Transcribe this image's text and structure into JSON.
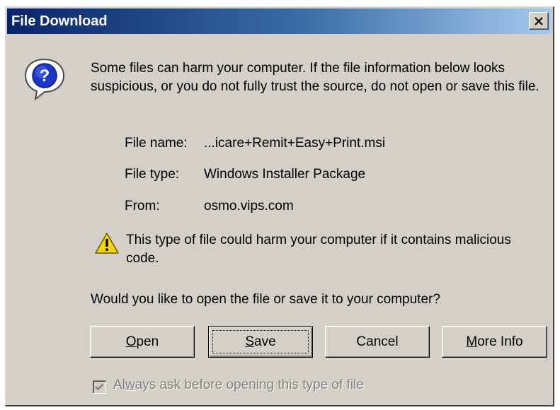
{
  "window": {
    "title": "File Download",
    "close_label": "X"
  },
  "message": "Some files can harm your computer. If the file information below looks suspicious, or you do not fully trust the source, do not open or save this file.",
  "file_info": {
    "name_label": "File name:",
    "name_value": "...icare+Remit+Easy+Print.msi",
    "type_label": "File type:",
    "type_value": "Windows Installer Package",
    "from_label": "From:",
    "from_value": "osmo.vips.com"
  },
  "warning": "This type of file could harm your computer if it contains malicious code.",
  "question": "Would you like to open the file or save it to your computer?",
  "buttons": {
    "open": {
      "mnemonic": "O",
      "rest": "pen"
    },
    "save": {
      "mnemonic": "S",
      "rest": "ave"
    },
    "cancel": "Cancel",
    "more_info": {
      "mnemonic": "M",
      "rest": "ore Info"
    }
  },
  "checkbox": {
    "label_pre": "Al",
    "mnemonic": "w",
    "label_post": "ays ask before opening this type of file",
    "checked": true,
    "disabled": true
  },
  "icons": {
    "question": "question-icon",
    "warning": "warning-icon",
    "close": "close-icon",
    "check": "checkmark-icon"
  },
  "colors": {
    "title_start": "#0a246a",
    "title_end": "#a6caf0",
    "face": "#d4d0c8"
  }
}
